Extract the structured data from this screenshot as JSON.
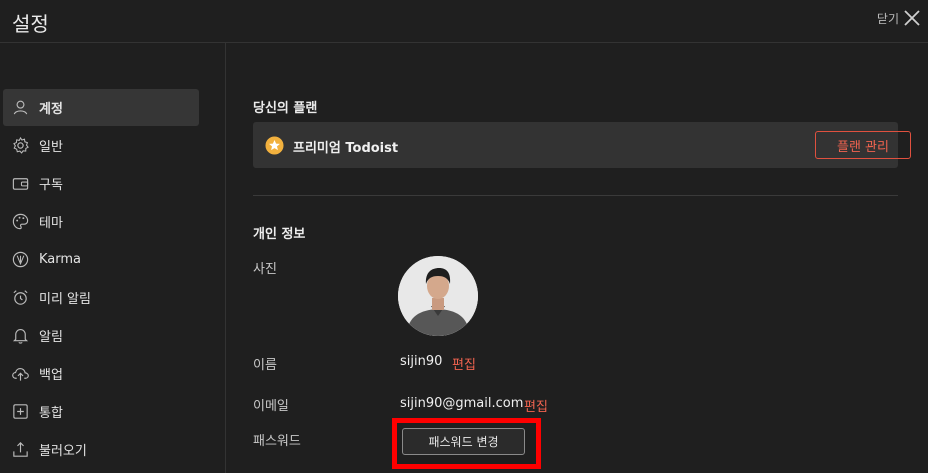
{
  "header": {
    "title": "설정",
    "close_label": "닫기"
  },
  "sidebar": {
    "items": [
      {
        "label": "계정",
        "icon": "user-icon",
        "active": true
      },
      {
        "label": "일반",
        "icon": "gear-icon"
      },
      {
        "label": "구독",
        "icon": "wallet-icon"
      },
      {
        "label": "테마",
        "icon": "palette-icon"
      },
      {
        "label": "Karma",
        "icon": "karma-icon"
      },
      {
        "label": "미리 알림",
        "icon": "alarm-clock-icon"
      },
      {
        "label": "알림",
        "icon": "bell-icon"
      },
      {
        "label": "백업",
        "icon": "cloud-upload-icon"
      },
      {
        "label": "통합",
        "icon": "integration-icon"
      },
      {
        "label": "불러오기",
        "icon": "import-icon"
      }
    ]
  },
  "plan": {
    "section_title": "당신의 플랜",
    "name": "프리미엄 Todoist",
    "icon": "star-icon",
    "manage_label": "플랜 관리"
  },
  "personal": {
    "section_title": "개인 정보",
    "photo_label": "사진",
    "name_label": "이름",
    "name_value": "sijin90",
    "email_label": "이메일",
    "email_value": "sijin90@gmail.com",
    "edit_label": "편집",
    "password_label": "패스워드",
    "change_password_label": "패스워드 변경"
  },
  "colors": {
    "accent": "#f0634f",
    "highlight": "#ff0000",
    "background": "#1f1f1f",
    "active_item": "#363636"
  }
}
